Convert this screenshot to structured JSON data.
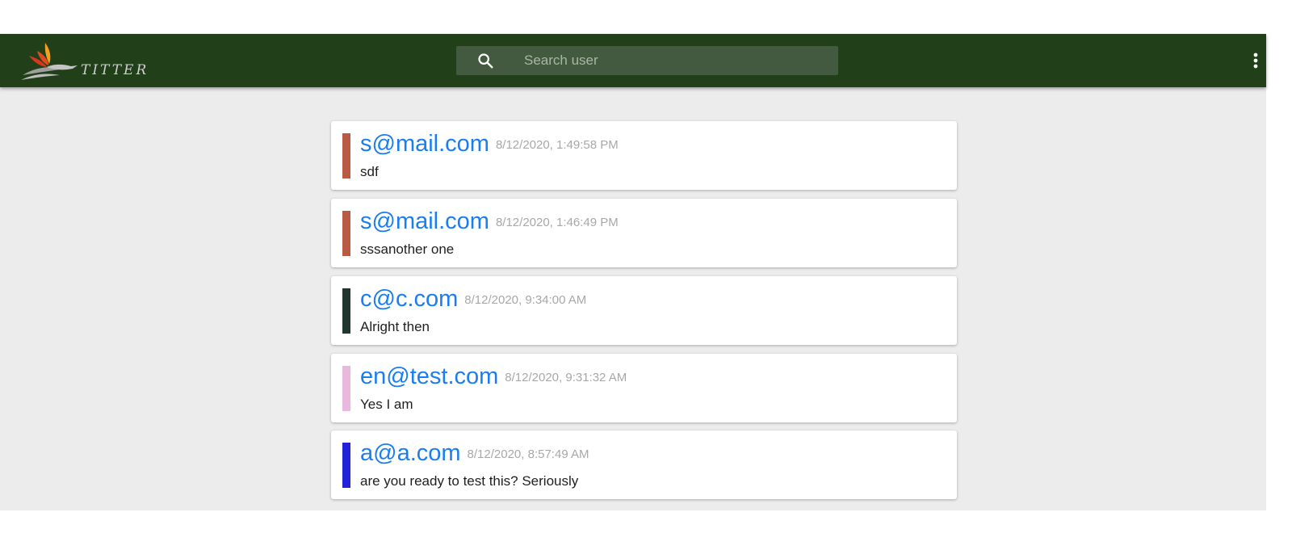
{
  "header": {
    "logo_text": "TITTER",
    "search": {
      "placeholder": "Search user",
      "value": ""
    }
  },
  "posts": [
    {
      "email": "s@mail.com",
      "timestamp": "8/12/2020, 1:49:58 PM",
      "message": "sdf",
      "color": "#b85a44"
    },
    {
      "email": "s@mail.com",
      "timestamp": "8/12/2020, 1:46:49 PM",
      "message": "sssanother one",
      "color": "#b85a44"
    },
    {
      "email": "c@c.com",
      "timestamp": "8/12/2020, 9:34:00 AM",
      "message": "Alright then",
      "color": "#223630"
    },
    {
      "email": "en@test.com",
      "timestamp": "8/12/2020, 9:31:32 AM",
      "message": "Yes I am",
      "color": "#eab8dc"
    },
    {
      "email": "a@a.com",
      "timestamp": "8/12/2020, 8:57:49 AM",
      "message": "are you ready to test this? Seriously",
      "color": "#2222d6"
    }
  ],
  "icons": {
    "logo": "bird-logo-icon",
    "search": "search-icon",
    "menu": "more-vert-icon"
  }
}
